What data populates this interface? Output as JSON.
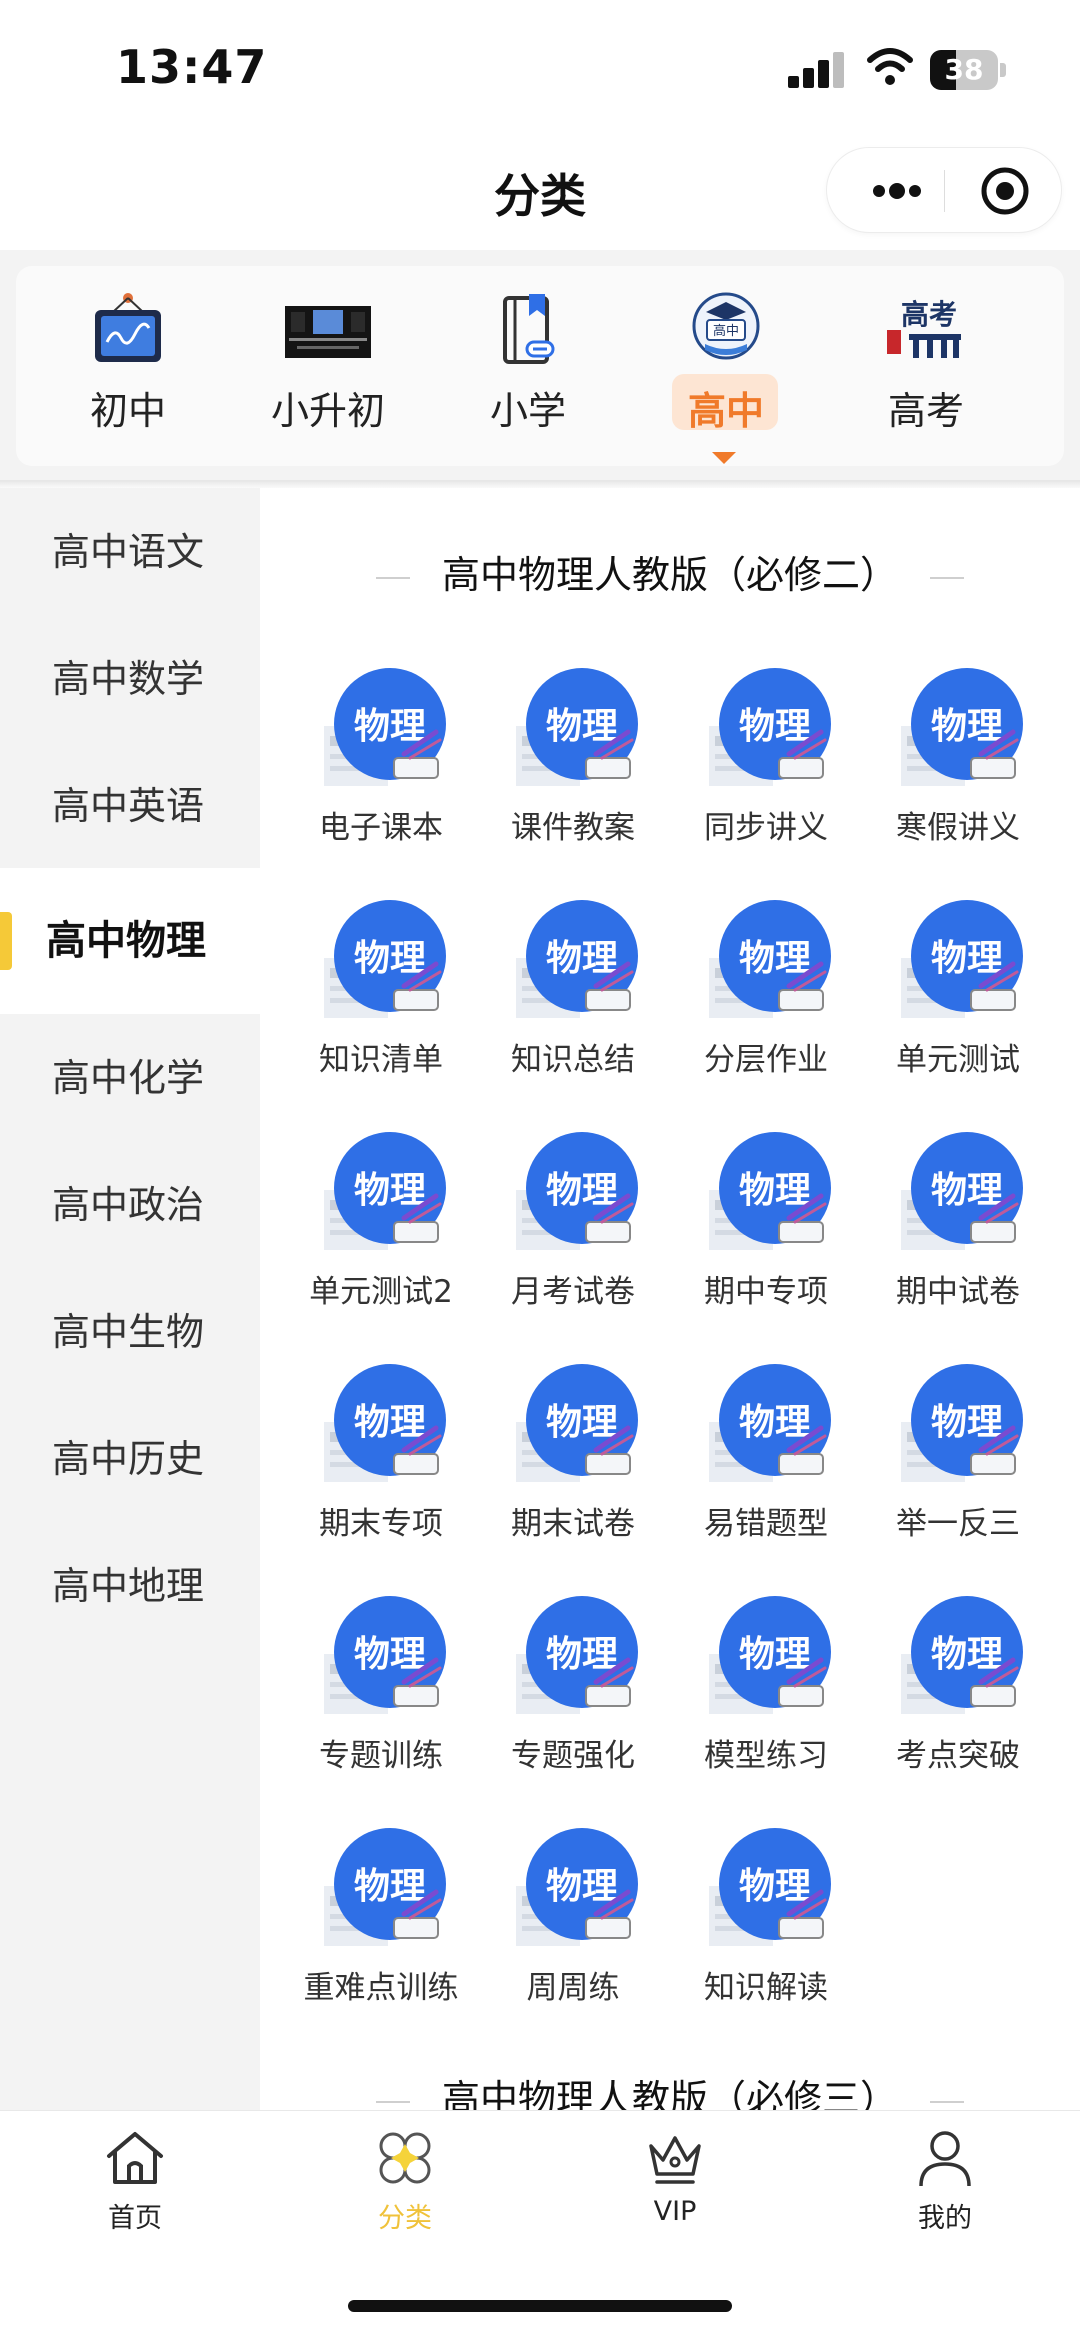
{
  "status": {
    "time": "13:47",
    "battery": "38",
    "battery_level": 0.38
  },
  "nav": {
    "title": "分类"
  },
  "levels": [
    {
      "label": "初中",
      "icon": "tablet-chart-icon",
      "active": false
    },
    {
      "label": "小升初",
      "icon": "banner-photo-icon",
      "active": false
    },
    {
      "label": "小学",
      "icon": "bookmark-book-icon",
      "active": false
    },
    {
      "label": "高中",
      "icon": "high-school-badge-icon",
      "active": true
    },
    {
      "label": "高考",
      "icon": "gaokao-building-icon",
      "active": false
    }
  ],
  "level_badge_text": "高中",
  "gaokao_badge_text": "高考",
  "sidebar": [
    {
      "label": "高中语文",
      "active": false
    },
    {
      "label": "高中数学",
      "active": false
    },
    {
      "label": "高中英语",
      "active": false
    },
    {
      "label": "高中物理",
      "active": true
    },
    {
      "label": "高中化学",
      "active": false
    },
    {
      "label": "高中政治",
      "active": false
    },
    {
      "label": "高中生物",
      "active": false
    },
    {
      "label": "高中历史",
      "active": false
    },
    {
      "label": "高中地理",
      "active": false
    }
  ],
  "sections": [
    {
      "title": "高中物理人教版（必修二）",
      "items": [
        "电子课本",
        "课件教案",
        "同步讲义",
        "寒假讲义",
        "知识清单",
        "知识总结",
        "分层作业",
        "单元测试",
        "单元测试2",
        "月考试卷",
        "期中专项",
        "期中试卷",
        "期末专项",
        "期末试卷",
        "易错题型",
        "举一反三",
        "专题训练",
        "专题强化",
        "模型练习",
        "考点突破",
        "重难点训练",
        "周周练",
        "知识解读"
      ]
    },
    {
      "title": "高中物理人教版（必修三）",
      "items": []
    }
  ],
  "icon_text": "物理",
  "tabbar": [
    {
      "label": "首页",
      "icon": "home-icon",
      "active": false
    },
    {
      "label": "分类",
      "icon": "category-icon",
      "active": true
    },
    {
      "label": "VIP",
      "icon": "crown-icon",
      "active": false
    },
    {
      "label": "我的",
      "icon": "user-icon",
      "active": false
    }
  ],
  "colors": {
    "accent_orange": "#f07a2a",
    "accent_yellow": "#f5c938",
    "icon_blue": "#2f6fe6"
  }
}
